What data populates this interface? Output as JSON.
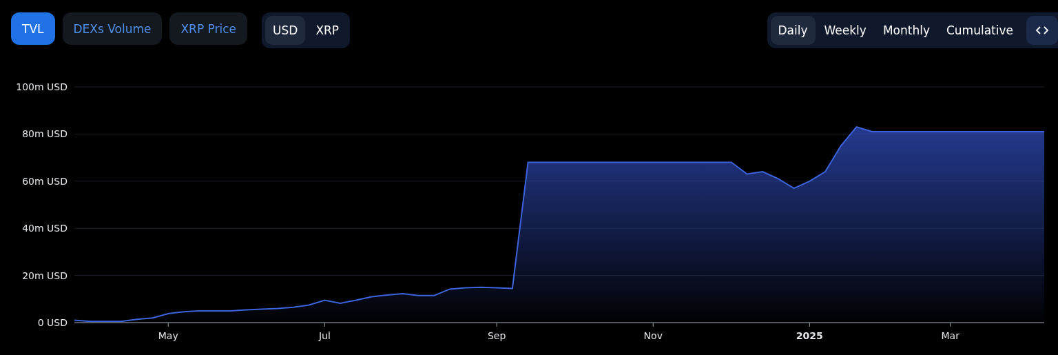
{
  "metric_tabs": [
    {
      "label": "TVL",
      "selected": true
    },
    {
      "label": "DEXs Volume",
      "selected": false
    },
    {
      "label": "XRP Price",
      "selected": false
    }
  ],
  "currency_toggle": [
    {
      "label": "USD",
      "selected": true
    },
    {
      "label": "XRP",
      "selected": false
    }
  ],
  "interval_tabs": [
    {
      "label": "Daily",
      "selected": true
    },
    {
      "label": "Weekly",
      "selected": false
    },
    {
      "label": "Monthly",
      "selected": false
    },
    {
      "label": "Cumulative",
      "selected": false
    }
  ],
  "chart": {
    "chart_data": {
      "type": "area",
      "categories": [
        null,
        null,
        null,
        null,
        null,
        null,
        "May",
        null,
        null,
        null,
        null,
        null,
        null,
        null,
        null,
        null,
        "Jul",
        null,
        null,
        null,
        null,
        null,
        null,
        null,
        null,
        null,
        null,
        "Sep",
        null,
        null,
        null,
        null,
        null,
        null,
        null,
        null,
        null,
        "Nov",
        null,
        null,
        null,
        null,
        null,
        null,
        null,
        null,
        null,
        "2025",
        null,
        null,
        null,
        null,
        null,
        null,
        null,
        null,
        "Mar",
        null,
        null,
        null,
        null,
        null,
        null
      ],
      "series": [
        {
          "color": "#3d63dd",
          "values": [
            1,
            0.5,
            0.5,
            0.5,
            1.4,
            2,
            3.8,
            4.6,
            5,
            5,
            5,
            5.4,
            5.7,
            6,
            6.5,
            7.5,
            9.5,
            8.2,
            9.5,
            11,
            11.7,
            12.3,
            11.5,
            11.5,
            14.2,
            14.8,
            15,
            14.8,
            14.5,
            68,
            68,
            68,
            68,
            68,
            68,
            68,
            68,
            68,
            68,
            68,
            68,
            68,
            68,
            63,
            64,
            61,
            57,
            60,
            64,
            75,
            83,
            81,
            81,
            81,
            81,
            81,
            81,
            81,
            81,
            81,
            81,
            81,
            81
          ]
        }
      ],
      "ylim": [
        0,
        100
      ],
      "grid": true,
      "yticks": [
        {
          "value": 0,
          "label": "0 USD"
        },
        {
          "value": 20,
          "label": "20m USD"
        },
        {
          "value": 40,
          "label": "40m USD"
        },
        {
          "value": 60,
          "label": "60m USD"
        },
        {
          "value": 80,
          "label": "80m USD"
        },
        {
          "value": 100,
          "label": "100m USD"
        }
      ]
    }
  }
}
